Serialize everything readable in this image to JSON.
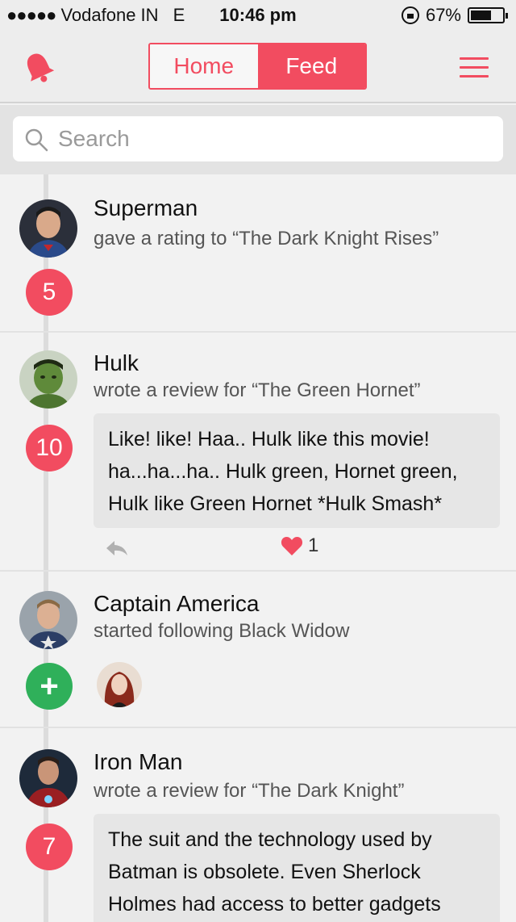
{
  "status_bar": {
    "carrier": "Vodafone IN",
    "network": "E",
    "time": "10:46 pm",
    "battery": "67%",
    "battery_level": 0.67
  },
  "nav": {
    "tabs": [
      "Home",
      "Feed"
    ],
    "active_tab": "Feed",
    "bell_icon": "bell-icon",
    "menu_icon": "hamburger-menu-icon",
    "accent_color": "#f24c60"
  },
  "search": {
    "placeholder": "Search"
  },
  "feed": [
    {
      "name": "Superman",
      "action": "gave a rating to “The Dark Knight Rises”",
      "badge": "5"
    },
    {
      "name": "Hulk",
      "action": "wrote a review for “The Green Hornet”",
      "badge": "10",
      "review": "Like! like! Haa.. Hulk like this movie! ha...ha...ha.. Hulk green, Hornet green, Hulk like Green Hornet *Hulk Smash*",
      "likes": "1"
    },
    {
      "name": "Captain America",
      "action": "started following Black Widow",
      "badge": "+"
    },
    {
      "name": "Iron Man",
      "action": "wrote a review for “The Dark Knight”",
      "badge": "7",
      "review": "The suit and the technology used by Batman is obsolete. Even Sherlock Holmes had access to better gadgets"
    }
  ],
  "colors": {
    "badge_red": "#f24c60",
    "badge_green": "#2fb05a"
  }
}
